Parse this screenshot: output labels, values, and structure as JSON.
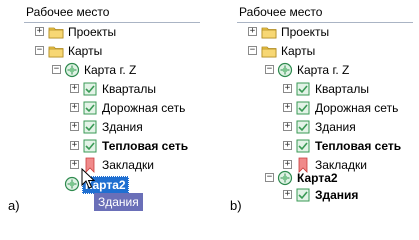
{
  "panel_a": {
    "title": "Рабочее место",
    "nodes": [
      {
        "label": "Проекты",
        "expander": "+",
        "icon": "folder-icon"
      },
      {
        "label": "Карты",
        "expander": "−",
        "icon": "folder-icon"
      },
      {
        "label": "Карта г. Z",
        "expander": "−",
        "icon": "map-icon"
      },
      {
        "label": "Кварталы",
        "expander": "+",
        "icon": "layer-icon"
      },
      {
        "label": "Дорожная сеть",
        "expander": "+",
        "icon": "layer-icon"
      },
      {
        "label": "Здания",
        "expander": "+",
        "icon": "layer-icon"
      },
      {
        "label": "Тепловая сеть",
        "expander": "+",
        "icon": "layer-icon"
      },
      {
        "label": "Закладки",
        "expander": "+",
        "icon": "bookmark-icon"
      },
      {
        "label": "Карта2",
        "icon": "map-icon"
      }
    ],
    "drag_label": "Здания",
    "caption": "a)"
  },
  "panel_b": {
    "title": "Рабочее место",
    "nodes": [
      {
        "label": "Проекты",
        "expander": "+",
        "icon": "folder-icon"
      },
      {
        "label": "Карты",
        "expander": "−",
        "icon": "folder-icon"
      },
      {
        "label": "Карта г. Z",
        "expander": "−",
        "icon": "map-icon"
      },
      {
        "label": "Кварталы",
        "expander": "+",
        "icon": "layer-icon"
      },
      {
        "label": "Дорожная сеть",
        "expander": "+",
        "icon": "layer-icon"
      },
      {
        "label": "Здания",
        "expander": "+",
        "icon": "layer-icon"
      },
      {
        "label": "Тепловая сеть",
        "expander": "+",
        "icon": "layer-icon"
      },
      {
        "label": "Закладки",
        "expander": "+",
        "icon": "bookmark-icon"
      },
      {
        "label": "Карта2",
        "expander": "−",
        "icon": "map-icon"
      },
      {
        "label": "Здания",
        "expander": "+",
        "icon": "layer-icon"
      }
    ],
    "caption": "b)"
  },
  "colors": {
    "selection": "#1f6fd1",
    "drag_ghost": "#6a6fb8",
    "folder": "#f2c94c",
    "layer": "#3a9a55",
    "bookmark": "#e05555"
  }
}
